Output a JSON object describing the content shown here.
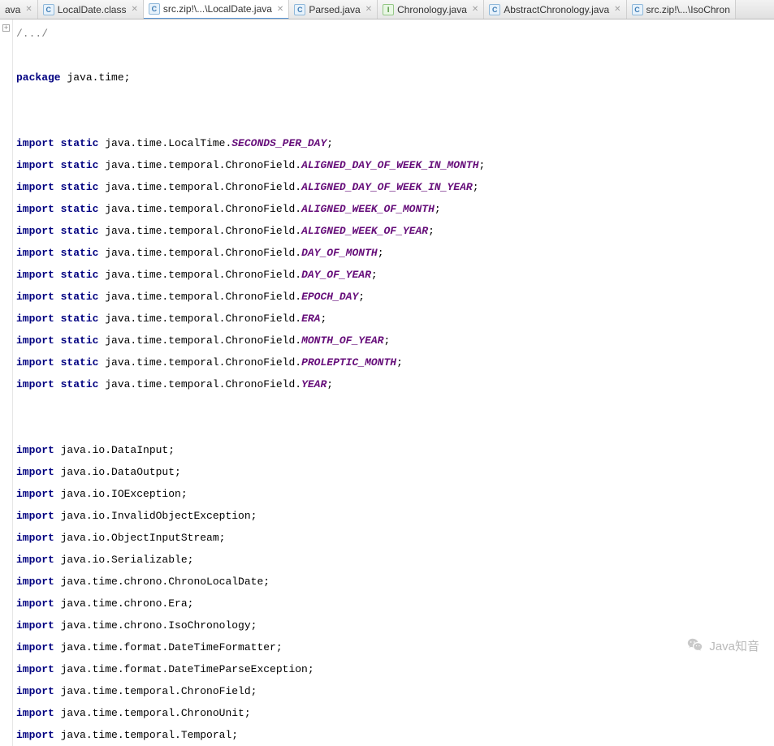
{
  "tabs": [
    {
      "icon": "J",
      "iconType": "class",
      "label": "ava",
      "truncatedLeft": true
    },
    {
      "icon": "C",
      "iconType": "class",
      "label": "LocalDate.class"
    },
    {
      "icon": "C",
      "iconType": "class",
      "label": "src.zip!\\...\\LocalDate.java",
      "active": true
    },
    {
      "icon": "C",
      "iconType": "class",
      "label": "Parsed.java"
    },
    {
      "icon": "I",
      "iconType": "interface",
      "label": "Chronology.java"
    },
    {
      "icon": "C",
      "iconType": "class",
      "label": "AbstractChronology.java"
    },
    {
      "icon": "C",
      "iconType": "class",
      "label": "src.zip!\\...\\IsoChron",
      "truncatedRight": true
    }
  ],
  "foldMarker": "+",
  "code": {
    "foldedComment": "/.../",
    "packageDecl": {
      "kw": "package",
      "rest": " java.time;"
    },
    "staticImports": [
      {
        "path": "java.time.LocalTime.",
        "constant": "SECONDS_PER_DAY"
      },
      {
        "path": "java.time.temporal.ChronoField.",
        "constant": "ALIGNED_DAY_OF_WEEK_IN_MONTH"
      },
      {
        "path": "java.time.temporal.ChronoField.",
        "constant": "ALIGNED_DAY_OF_WEEK_IN_YEAR"
      },
      {
        "path": "java.time.temporal.ChronoField.",
        "constant": "ALIGNED_WEEK_OF_MONTH"
      },
      {
        "path": "java.time.temporal.ChronoField.",
        "constant": "ALIGNED_WEEK_OF_YEAR"
      },
      {
        "path": "java.time.temporal.ChronoField.",
        "constant": "DAY_OF_MONTH"
      },
      {
        "path": "java.time.temporal.ChronoField.",
        "constant": "DAY_OF_YEAR"
      },
      {
        "path": "java.time.temporal.ChronoField.",
        "constant": "EPOCH_DAY"
      },
      {
        "path": "java.time.temporal.ChronoField.",
        "constant": "ERA"
      },
      {
        "path": "java.time.temporal.ChronoField.",
        "constant": "MONTH_OF_YEAR"
      },
      {
        "path": "java.time.temporal.ChronoField.",
        "constant": "PROLEPTIC_MONTH"
      },
      {
        "path": "java.time.temporal.ChronoField.",
        "constant": "YEAR"
      }
    ],
    "imports": [
      "java.io.DataInput;",
      "java.io.DataOutput;",
      "java.io.IOException;",
      "java.io.InvalidObjectException;",
      "java.io.ObjectInputStream;",
      "java.io.Serializable;",
      "java.time.chrono.ChronoLocalDate;",
      "java.time.chrono.Era;",
      "java.time.chrono.IsoChronology;",
      "java.time.format.DateTimeFormatter;",
      "java.time.format.DateTimeParseException;",
      "java.time.temporal.ChronoField;",
      "java.time.temporal.ChronoUnit;",
      "java.time.temporal.Temporal;"
    ],
    "kwImport": "import",
    "kwStatic": "static"
  },
  "watermark": {
    "text": "Java知音"
  }
}
